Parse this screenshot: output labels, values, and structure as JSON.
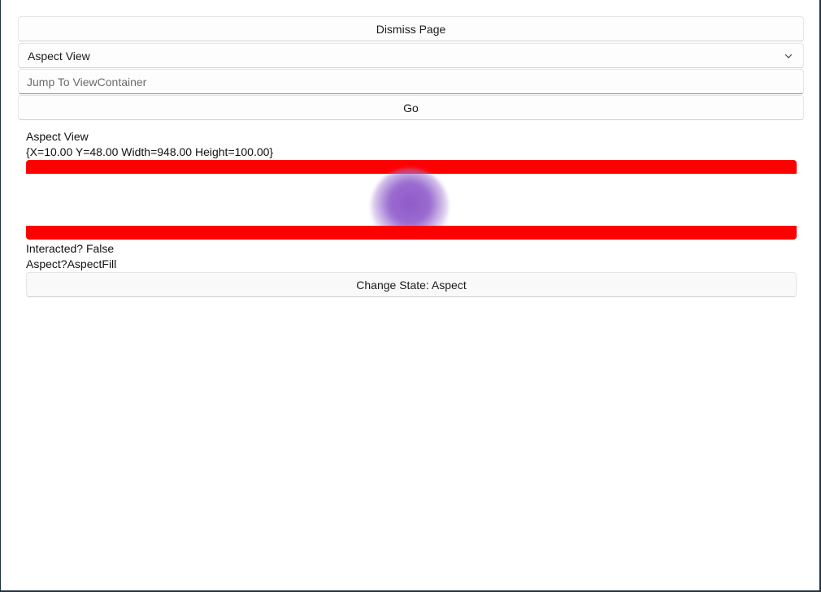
{
  "header": {
    "dismiss_label": "Dismiss Page",
    "picker_value": "Aspect View",
    "jump_placeholder": "Jump To ViewContainer",
    "jump_value": "",
    "go_label": "Go"
  },
  "view": {
    "title": "Aspect View",
    "bounds": "{X=10.00 Y=48.00 Width=948.00 Height=100.00}",
    "interacted": "Interacted? False",
    "aspect": "Aspect?AspectFill",
    "change_label": "Change State: Aspect"
  },
  "colors": {
    "letterbox": "#ff0000",
    "image_tint": "#8f5ac8"
  },
  "icons": {
    "picker_chevron": "chevron-down-icon"
  }
}
